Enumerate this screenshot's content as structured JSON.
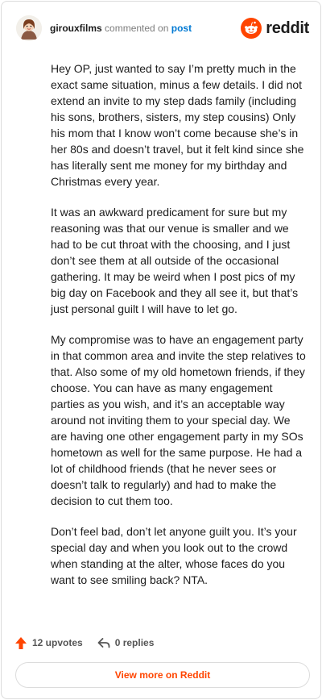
{
  "header": {
    "username": "girouxfilms",
    "action": "commented on",
    "link": "post",
    "brand": "reddit"
  },
  "comment": {
    "paragraphs": [
      "Hey OP, just wanted to say I’m pretty much in the exact same situation, minus a few details. I did not extend an invite to my step dads family (including his sons, brothers, sisters, my step cousins) Only his mom that I know won’t come because she’s in her 80s and doesn’t travel, but it felt kind since she has literally sent me money for my birthday and Christmas every year.",
      "It was an awkward predicament for sure but my reasoning was that our venue is smaller and we had to be cut throat with the choosing, and I just don’t see them at all outside of the occasional gathering. It may be weird when I post pics of my big day on Facebook and they all see it, but that’s just personal guilt I will have to let go.",
      "My compromise was to have an engagement party in that common area and invite the step relatives to that. Also some of my old hometown friends, if they choose. You can have as many engagement parties as you wish, and it’s an acceptable way around not inviting them to your special day. We are having one other engagement party in my SOs hometown as well for the same purpose. He had a lot of childhood friends (that he never sees or doesn’t talk to regularly) and had to make the decision to cut them too.",
      "Don’t feel bad, don’t let anyone guilt you. It’s your special day and when you look out to the crowd when standing at the alter, whose faces do you want to see smiling back? NTA."
    ]
  },
  "footer": {
    "upvotes": "12 upvotes",
    "replies": "0 replies",
    "view_more": "View more on Reddit"
  },
  "icons": {
    "upvote": "upvote-arrow-icon",
    "reply": "reply-arrow-icon",
    "brand": "reddit-snoo-icon"
  },
  "colors": {
    "accent": "#ff4500",
    "link": "#0079d3",
    "text": "#1c1c1c",
    "muted": "#7c7c7c",
    "border": "#dcdcdc"
  }
}
